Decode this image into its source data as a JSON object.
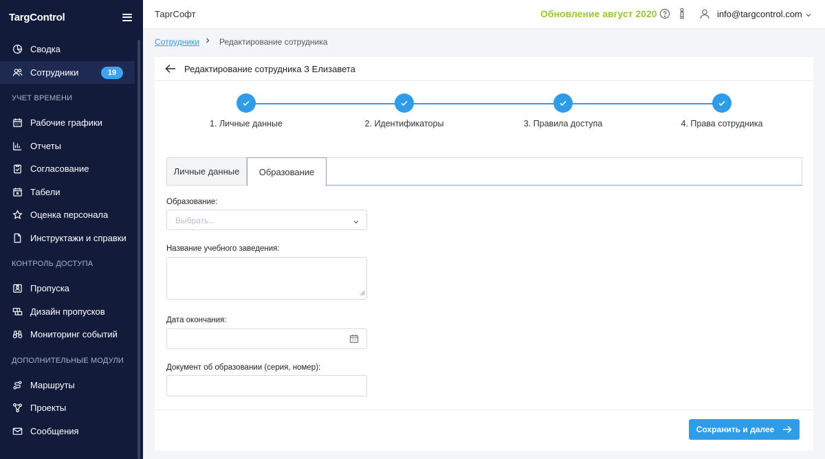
{
  "app": {
    "logo": "TargControl",
    "company": "ТаргСофт"
  },
  "header": {
    "update_label": "Обновление август 2020",
    "user_email": "info@targcontrol.com"
  },
  "sidebar": {
    "items_top": [
      {
        "label": "Сводка",
        "icon": "pie-chart-icon"
      },
      {
        "label": "Сотрудники",
        "icon": "users-icon",
        "badge": "19",
        "active": true
      }
    ],
    "sections": [
      {
        "title": "Учет времени",
        "items": [
          {
            "label": "Рабочие графики",
            "icon": "calendar-icon"
          },
          {
            "label": "Отчеты",
            "icon": "bar-chart-icon"
          },
          {
            "label": "Согласование",
            "icon": "clipboard-check-icon"
          },
          {
            "label": "Табели",
            "icon": "calendar-x-icon"
          },
          {
            "label": "Оценка персонала",
            "icon": "star-icon"
          },
          {
            "label": "Инструктажи и справки",
            "icon": "document-icon"
          }
        ]
      },
      {
        "title": "Контроль доступа",
        "items": [
          {
            "label": "Пропуска",
            "icon": "badge-icon"
          },
          {
            "label": "Дизайн пропусков",
            "icon": "design-icon"
          },
          {
            "label": "Мониторинг событий",
            "icon": "binoculars-icon"
          }
        ]
      },
      {
        "title": "Дополнительные модули",
        "items": [
          {
            "label": "Маршруты",
            "icon": "route-icon"
          },
          {
            "label": "Проекты",
            "icon": "projects-icon"
          },
          {
            "label": "Сообщения",
            "icon": "mail-icon"
          }
        ]
      }
    ]
  },
  "breadcrumb": {
    "parent": "Сотрудники",
    "current": "Редактирование сотрудника"
  },
  "card": {
    "title": "Редактирование сотрудника З Елизавета"
  },
  "steps": [
    {
      "label": "1. Личные данные"
    },
    {
      "label": "2. Идентификаторы"
    },
    {
      "label": "3. Правила доступа"
    },
    {
      "label": "4. Права сотрудника"
    }
  ],
  "tabs": [
    {
      "label": "Личные данные"
    },
    {
      "label": "Образование"
    }
  ],
  "form": {
    "education_label": "Образование:",
    "education_placeholder": "Выбрать...",
    "institution_label": "Название учебного заведения:",
    "end_date_label": "Дата окончания:",
    "document_label": "Документ об образовании (серия, номер):"
  },
  "actions": {
    "save_next": "Сохранить и далее"
  },
  "colors": {
    "sidebar": "#131b3b",
    "accent": "#2f9ce8",
    "update": "#9ac532"
  }
}
